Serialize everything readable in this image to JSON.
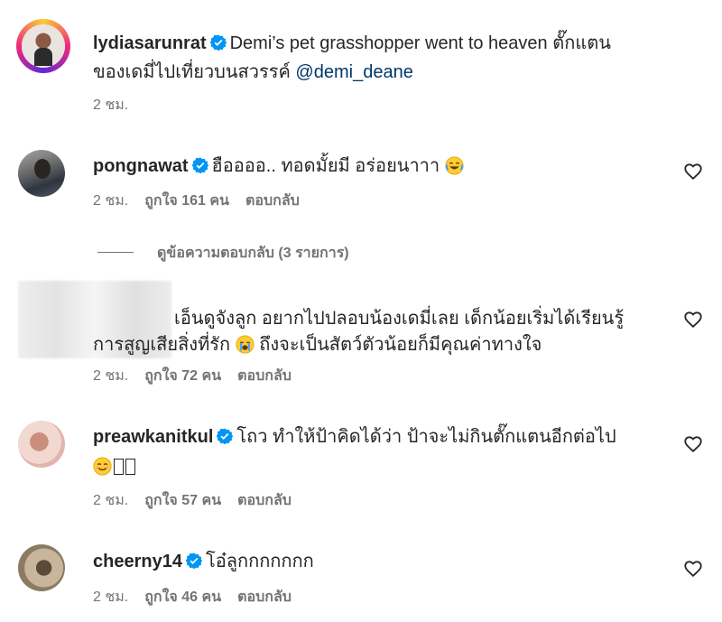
{
  "caption": {
    "username": "lydiasarunrat",
    "text_line1": "Demi’s pet grasshopper went to heaven ตั๊กแตน",
    "text_line2": "ของเดมี่ไปเที่ยวบนสวรรค์",
    "mention": "@demi_deane",
    "time": "2 ชม."
  },
  "comments": [
    {
      "username": "pongnawat",
      "text": "ฮืออออ.. ทอดมั้ยมี อร่อยนาาา",
      "time": "2 ชม.",
      "likes": "ถูกใจ 161 คน",
      "reply": "ตอบกลับ"
    },
    {
      "username": "",
      "text_line1": "เอ็นดูจังลูก อยากไปปลอบน้องเดมี่เลย เด็กน้อยเริ่มได้เรียนรู้",
      "text_line2": "การสูญเสียสิ่งที่รัก",
      "text_line2b": "ถึงจะเป็นสัตว์ตัวน้อยก็มีคุณค่าทางใจ",
      "time": "2 ชม.",
      "likes": "ถูกใจ 72 คน",
      "reply": "ตอบกลับ"
    },
    {
      "username": "preawkanitkul",
      "text": "โถว ทำให้ป้าคิดได้ว่า ป้าจะไม่กินตั๊กแตนอีกต่อไป",
      "time": "2 ชม.",
      "likes": "ถูกใจ 57 คน",
      "reply": "ตอบกลับ"
    },
    {
      "username": "cheerny14",
      "text": "โอ๋ลูกกกกกกก",
      "time": "2 ชม.",
      "likes": "ถูกใจ 46 คน",
      "reply": "ตอบกลับ"
    }
  ],
  "view_replies": "ดูข้อความตอบกลับ (3 รายการ)",
  "icons": {
    "verified": "verified-badge-icon",
    "like": "heart-icon",
    "emoji_laugh": "face-with-tears-of-joy",
    "emoji_cry": "loudly-crying-face",
    "emoji_smile": "smiling-face"
  },
  "colors": {
    "verified_blue": "#0095f6",
    "mention": "#00376b",
    "meta_gray": "#737373",
    "text": "#262626"
  }
}
